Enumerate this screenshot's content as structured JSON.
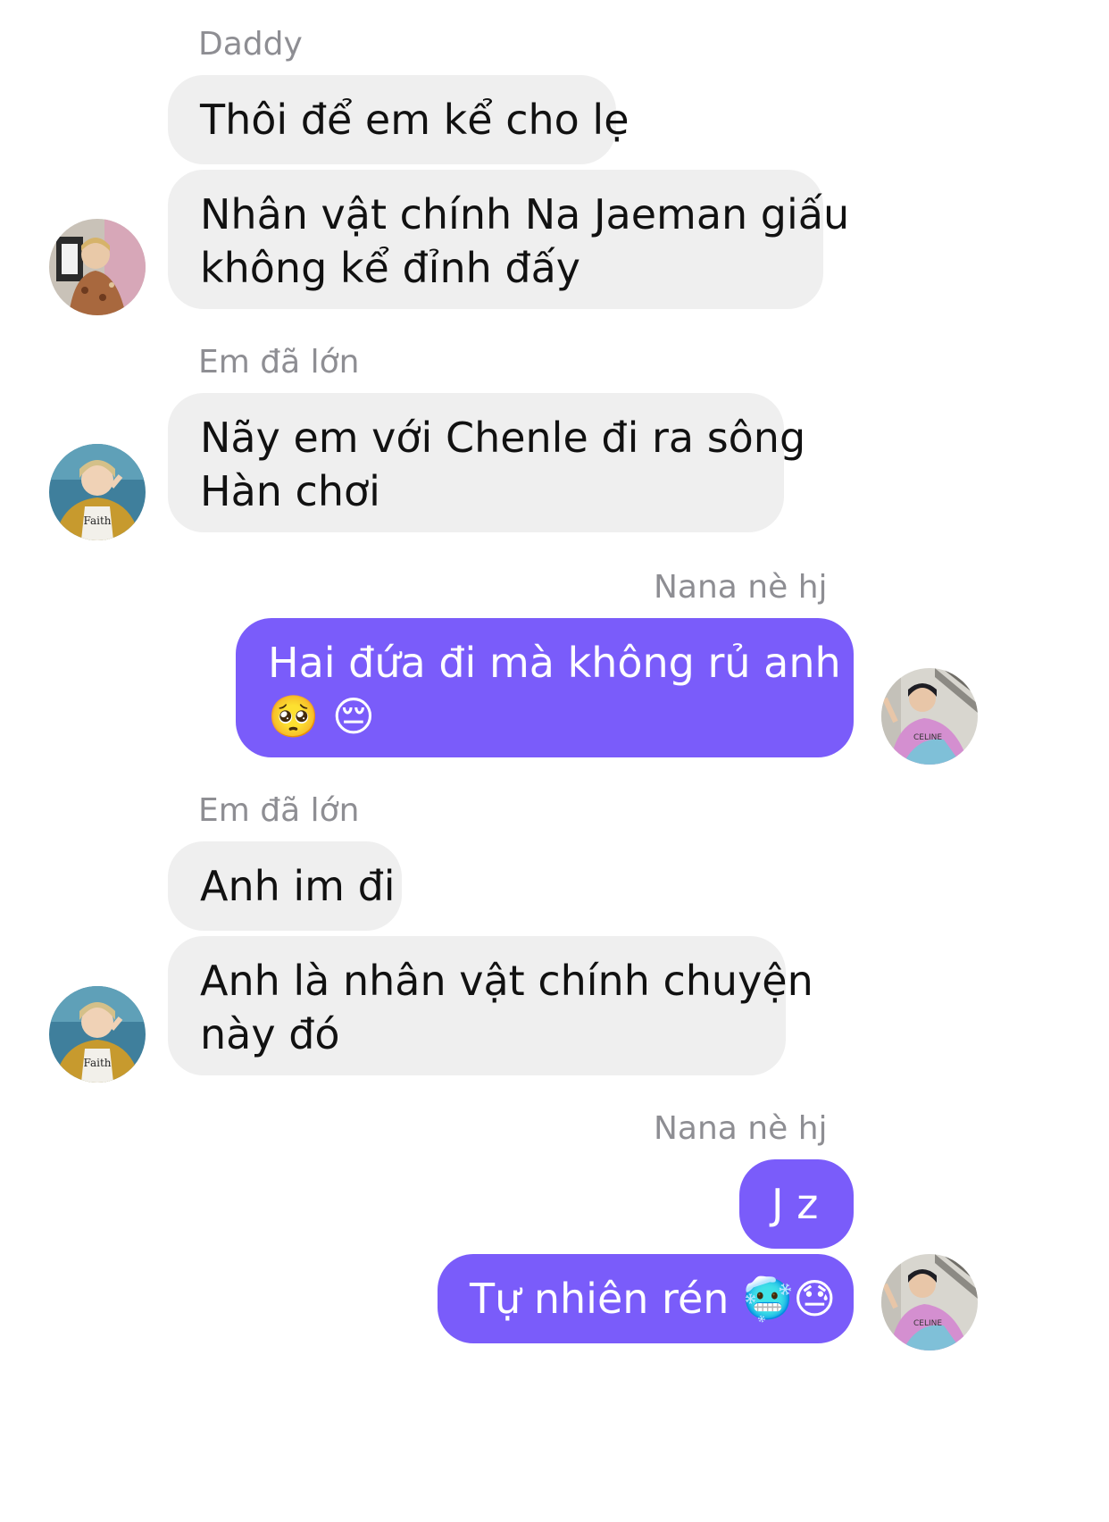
{
  "colors": {
    "incoming_bubble": "#efefef",
    "outgoing_bubble": "#7a5cfa",
    "sender_name": "#8e8e93"
  },
  "messages": [
    {
      "sender": "Daddy",
      "avatar": "daddy-avatar",
      "bubbles": [
        {
          "line1": "Thôi để em kể cho lẹ"
        },
        {
          "line1": "Nhân vật chính Na Jaeman giấu",
          "line2": "không kể đỉnh đấy"
        }
      ]
    },
    {
      "sender": "Em đã lớn",
      "avatar": "emdalon-avatar",
      "bubbles": [
        {
          "line1": "Nãy em với Chenle đi ra sông",
          "line2": "Hàn chơi"
        }
      ]
    },
    {
      "sender": "Nana nè hj",
      "avatar": "nana-avatar",
      "bubbles": [
        {
          "line1": "Hai đứa đi mà không rủ anh á",
          "line2": "🥺 😔"
        }
      ]
    },
    {
      "sender": "Em đã lớn",
      "avatar": "emdalon-avatar",
      "bubbles": [
        {
          "line1": "Anh im đi"
        },
        {
          "line1": "Anh là nhân vật chính chuyện",
          "line2": "này đó"
        }
      ]
    },
    {
      "sender": "Nana nè hj",
      "avatar": "nana-avatar",
      "bubbles": [
        {
          "line1": "J z"
        },
        {
          "line1": "Tự nhiên rén 🥶😓"
        }
      ]
    }
  ]
}
